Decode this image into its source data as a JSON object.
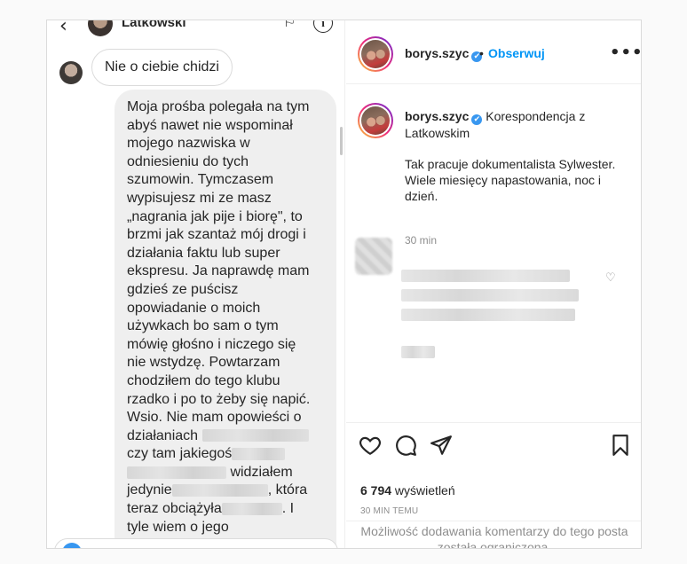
{
  "dm": {
    "contact_name": "Latkowski",
    "incoming_message": "Nie o ciebie chidzi",
    "outgoing_message_lines": [
      "Moja prośba polegała na tym",
      "abyś nawet nie wspominał",
      "mojego nazwiska w",
      "odniesieniu do tych",
      "szumowin. Tymczasem",
      "wypisujesz mi ze masz",
      "„nagrania jak pije i biorę\", to",
      "brzmi jak szantaż mój drogi i",
      "działania faktu lub super",
      "ekspresu. Ja naprawdę mam",
      "gdzieś ze puścisz",
      "opowiadanie o moich",
      "używkach bo sam o tym",
      "mówię głośno i niczego się",
      "nie wstydzę. Powtarzam",
      "chodziłem do tego klubu",
      "rzadko i po to żeby się napić.",
      "Wsio. Nie mam opowieści o"
    ],
    "redacted_line_1": "działaniach",
    "redacted_line_2": "czy tam jakiegoś",
    "redacted_line_3_end": " widziałem",
    "redacted_line_4_start": "jedynie",
    "redacted_line_4_end": ", która",
    "redacted_line_5_start": "teraz obciążyła",
    "redacted_line_5_end": ". I",
    "last_line": "tyle wiem o jego"
  },
  "post": {
    "username": "borys.szyc",
    "verified_glyph": "✔",
    "separator": "•",
    "follow_label": "Obserwuj",
    "more_glyph": "•••",
    "caption_title": "Korespondencja z Latkowskim",
    "caption_body": "Tak pracuje dokumentalista Sylwester.\nWiele miesięcy napastowania, noc i\ndzień.",
    "caption_time": "30 min",
    "views_count": "6 794",
    "views_label": " wyświetleń",
    "posted_ago": "30 MIN TEMU",
    "comments_disabled": "Możliwość dodawania komentarzy do tego posta została ograniczona."
  },
  "icons": {
    "back": "‹",
    "flag": "⚐",
    "info": "i",
    "heart_small": "♡"
  },
  "colors": {
    "link": "#0095f6",
    "muted": "#8e8e8e",
    "bubble": "#efefef",
    "border": "#dbdbdb"
  }
}
